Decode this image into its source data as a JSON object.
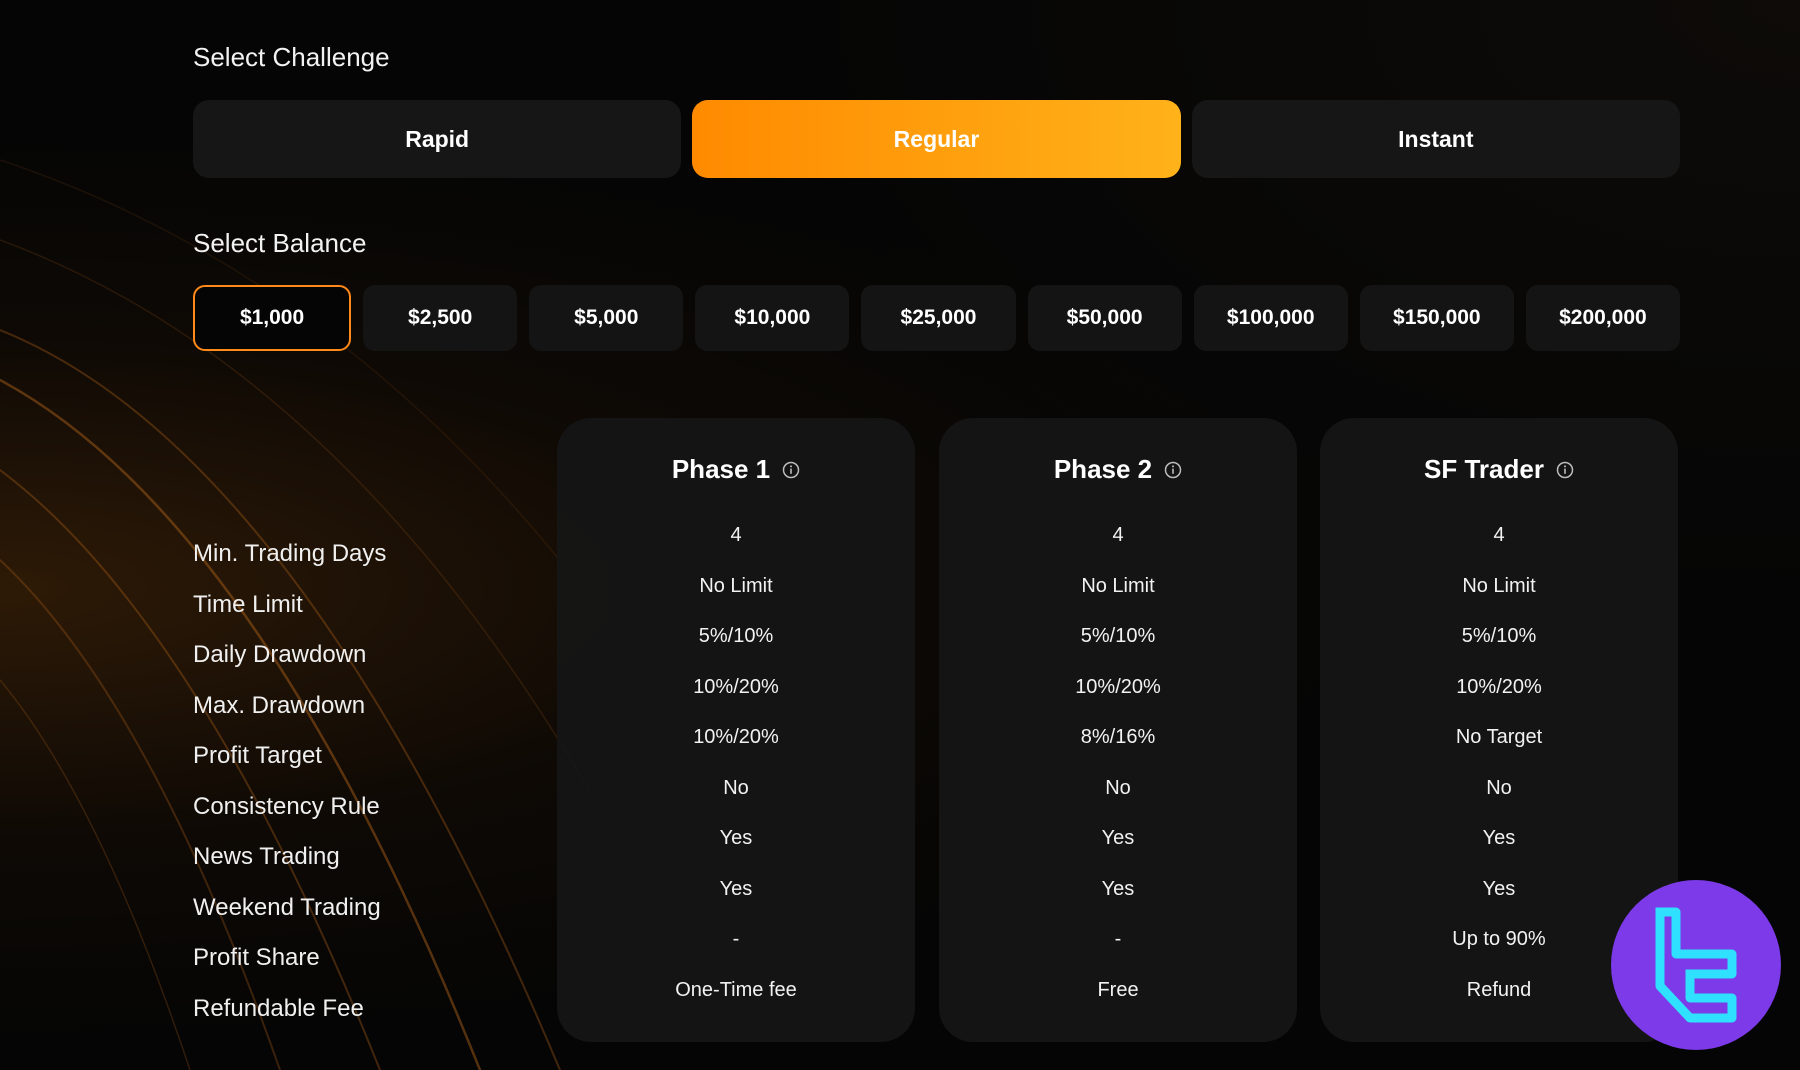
{
  "challenge": {
    "label": "Select Challenge",
    "options": [
      {
        "label": "Rapid",
        "selected": false
      },
      {
        "label": "Regular",
        "selected": true
      },
      {
        "label": "Instant",
        "selected": false
      }
    ]
  },
  "balance": {
    "label": "Select Balance",
    "options": [
      {
        "label": "$1,000",
        "selected": true
      },
      {
        "label": "$2,500",
        "selected": false
      },
      {
        "label": "$5,000",
        "selected": false
      },
      {
        "label": "$10,000",
        "selected": false
      },
      {
        "label": "$25,000",
        "selected": false
      },
      {
        "label": "$50,000",
        "selected": false
      },
      {
        "label": "$100,000",
        "selected": false
      },
      {
        "label": "$150,000",
        "selected": false
      },
      {
        "label": "$200,000",
        "selected": false
      }
    ]
  },
  "rules": {
    "rows": [
      "Min. Trading Days",
      "Time Limit",
      "Daily Drawdown",
      "Max. Drawdown",
      "Profit Target",
      "Consistency Rule",
      "News Trading",
      "Weekend Trading",
      "Profit Share",
      "Refundable Fee"
    ],
    "phases": [
      {
        "title": "Phase 1",
        "icon": "info-icon",
        "values": [
          "4",
          "No Limit",
          "5%/10%",
          "10%/20%",
          "10%/20%",
          "No",
          "Yes",
          "Yes",
          "-",
          "One-Time fee"
        ]
      },
      {
        "title": "Phase 2",
        "icon": "info-icon",
        "values": [
          "4",
          "No Limit",
          "5%/10%",
          "10%/20%",
          "8%/16%",
          "No",
          "Yes",
          "Yes",
          "-",
          "Free"
        ]
      },
      {
        "title": "SF Trader",
        "icon": "info-icon",
        "values": [
          "4",
          "No Limit",
          "5%/10%",
          "10%/20%",
          "No Target",
          "No",
          "Yes",
          "Yes",
          "Up to 90%",
          "Refund"
        ]
      }
    ]
  },
  "brand": {
    "icon": "tradingfinder-logo",
    "badge_color": "#7c3ae8",
    "logo_color": "#2fe0ff"
  },
  "colors": {
    "accent_start": "#ff8a00",
    "accent_end": "#ffb21a",
    "selected_border": "#ff8a1a",
    "background": "#050505",
    "button_bg": "#161616",
    "card_bg": "#161616"
  }
}
